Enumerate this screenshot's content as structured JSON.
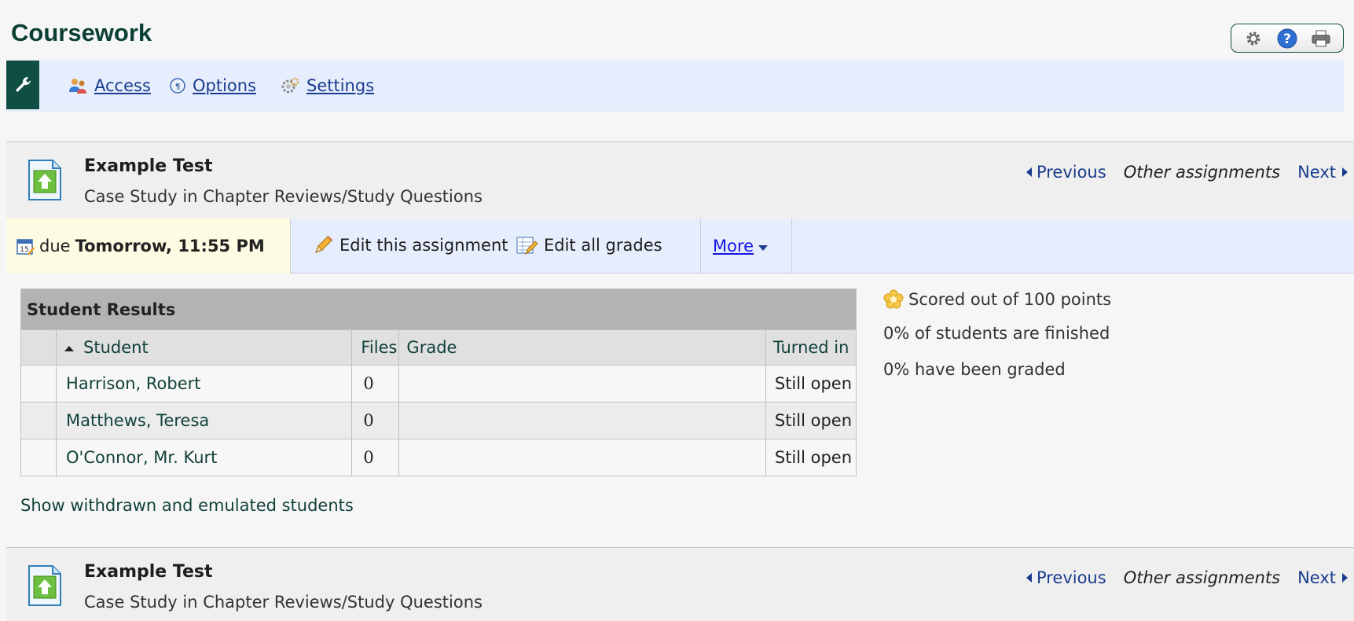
{
  "page": {
    "title": "Coursework"
  },
  "tools": {
    "icons": [
      "gear-icon",
      "help-icon",
      "print-icon"
    ]
  },
  "toolbar": {
    "access_label": "Access",
    "options_label": "Options",
    "settings_label": "Settings"
  },
  "assignment": {
    "title": "Example Test",
    "subtitle": "Case Study in Chapter Reviews/Study Questions",
    "nav": {
      "previous": "Previous",
      "other": "Other assignments",
      "next": "Next"
    }
  },
  "actions": {
    "due_prefix": "due",
    "due_value": "Tomorrow, 11:55 PM",
    "edit_assignment": "Edit this assignment",
    "edit_grades": "Edit all grades",
    "more": "More"
  },
  "results": {
    "caption": "Student Results",
    "columns": {
      "student": "Student",
      "files": "Files",
      "grade": "Grade",
      "turned_in": "Turned in"
    },
    "rows": [
      {
        "student": "Harrison, Robert",
        "files": "0",
        "grade": "",
        "turned_in": "Still open"
      },
      {
        "student": "Matthews, Teresa",
        "files": "0",
        "grade": "",
        "turned_in": "Still open"
      },
      {
        "student": "O'Connor, Mr. Kurt",
        "files": "0",
        "grade": "",
        "turned_in": "Still open"
      }
    ]
  },
  "stats": {
    "scored": "Scored out of 100 points",
    "finished": "0% of students are finished",
    "graded": "0% have been graded"
  },
  "show_withdrawn": "Show withdrawn and emulated students",
  "colors": {
    "brand": "#0f4f43",
    "toolbar_bg": "#e6eefd",
    "due_bg": "#fdfbe1",
    "link": "#1a3c8e"
  }
}
